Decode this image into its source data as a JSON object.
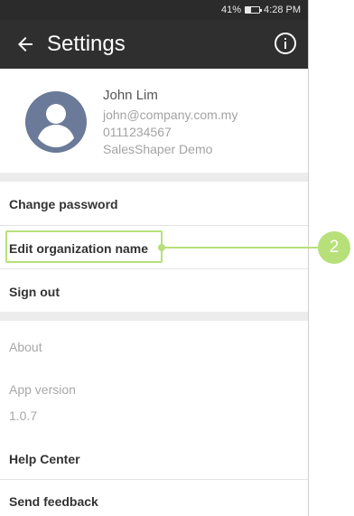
{
  "statusbar": {
    "battery": "41%",
    "battery_level": 0.41,
    "time": "4:28 PM"
  },
  "toolbar": {
    "title": "Settings"
  },
  "profile": {
    "name": "John Lim",
    "email": "john@company.com.my",
    "phone": "0111234567",
    "org": "SalesShaper Demo"
  },
  "menu": {
    "change_password": "Change password",
    "edit_org": "Edit organization name",
    "sign_out": "Sign out"
  },
  "about": {
    "heading": "About",
    "app_version_label": "App version",
    "app_version_value": "1.0.7",
    "help_center": "Help Center",
    "send_feedback": "Send feedback"
  },
  "callout": {
    "number": "2"
  },
  "colors": {
    "toolbar": "#2f2f2f",
    "accent": "#b7e07a",
    "avatar": "#6b7a99"
  }
}
